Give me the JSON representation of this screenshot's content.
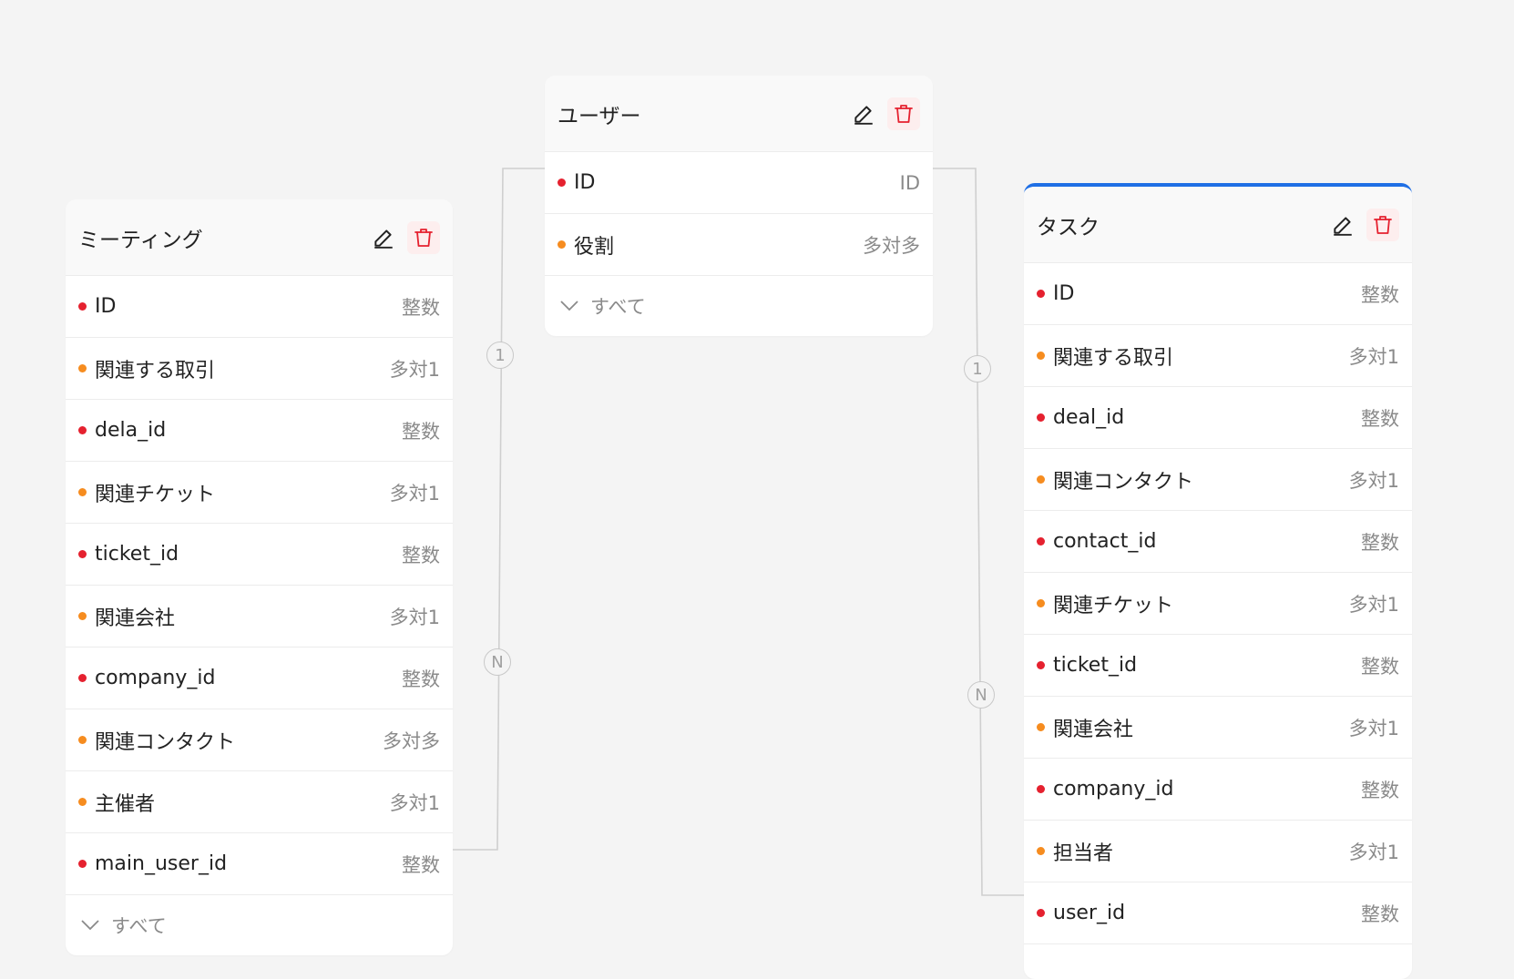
{
  "connectors": {
    "meeting_user": {
      "start_label": "1",
      "end_label": "N"
    },
    "task_user": {
      "start_label": "1",
      "end_label": "N"
    }
  },
  "colors": {
    "primary_key_dot": "#e5212f",
    "relation_dot": "#f68c1f",
    "selected_accent": "#1f6fe5",
    "delete_icon": "#e5212f"
  },
  "tables": {
    "meeting": {
      "title": "ミーティング",
      "show_all_label": "すべて",
      "fields": [
        {
          "name": "ID",
          "type": "整数",
          "kind": "red"
        },
        {
          "name": "関連する取引",
          "type": "多対1",
          "kind": "orange"
        },
        {
          "name": "dela_id",
          "type": "整数",
          "kind": "red"
        },
        {
          "name": "関連チケット",
          "type": "多対1",
          "kind": "orange"
        },
        {
          "name": "ticket_id",
          "type": "整数",
          "kind": "red"
        },
        {
          "name": "関連会社",
          "type": "多対1",
          "kind": "orange"
        },
        {
          "name": "company_id",
          "type": "整数",
          "kind": "red"
        },
        {
          "name": "関連コンタクト",
          "type": "多対多",
          "kind": "orange"
        },
        {
          "name": "主催者",
          "type": "多対1",
          "kind": "orange"
        },
        {
          "name": "main_user_id",
          "type": "整数",
          "kind": "red"
        }
      ]
    },
    "user": {
      "title": "ユーザー",
      "show_all_label": "すべて",
      "fields": [
        {
          "name": "ID",
          "type": "ID",
          "kind": "red"
        },
        {
          "name": "役割",
          "type": "多対多",
          "kind": "orange"
        }
      ]
    },
    "task": {
      "title": "タスク",
      "fields": [
        {
          "name": "ID",
          "type": "整数",
          "kind": "red"
        },
        {
          "name": "関連する取引",
          "type": "多対1",
          "kind": "orange"
        },
        {
          "name": "deal_id",
          "type": "整数",
          "kind": "red"
        },
        {
          "name": "関連コンタクト",
          "type": "多対1",
          "kind": "orange"
        },
        {
          "name": "contact_id",
          "type": "整数",
          "kind": "red"
        },
        {
          "name": "関連チケット",
          "type": "多対1",
          "kind": "orange"
        },
        {
          "name": "ticket_id",
          "type": "整数",
          "kind": "red"
        },
        {
          "name": "関連会社",
          "type": "多対1",
          "kind": "orange"
        },
        {
          "name": "company_id",
          "type": "整数",
          "kind": "red"
        },
        {
          "name": "担当者",
          "type": "多対1",
          "kind": "orange"
        },
        {
          "name": "user_id",
          "type": "整数",
          "kind": "red"
        }
      ]
    }
  }
}
